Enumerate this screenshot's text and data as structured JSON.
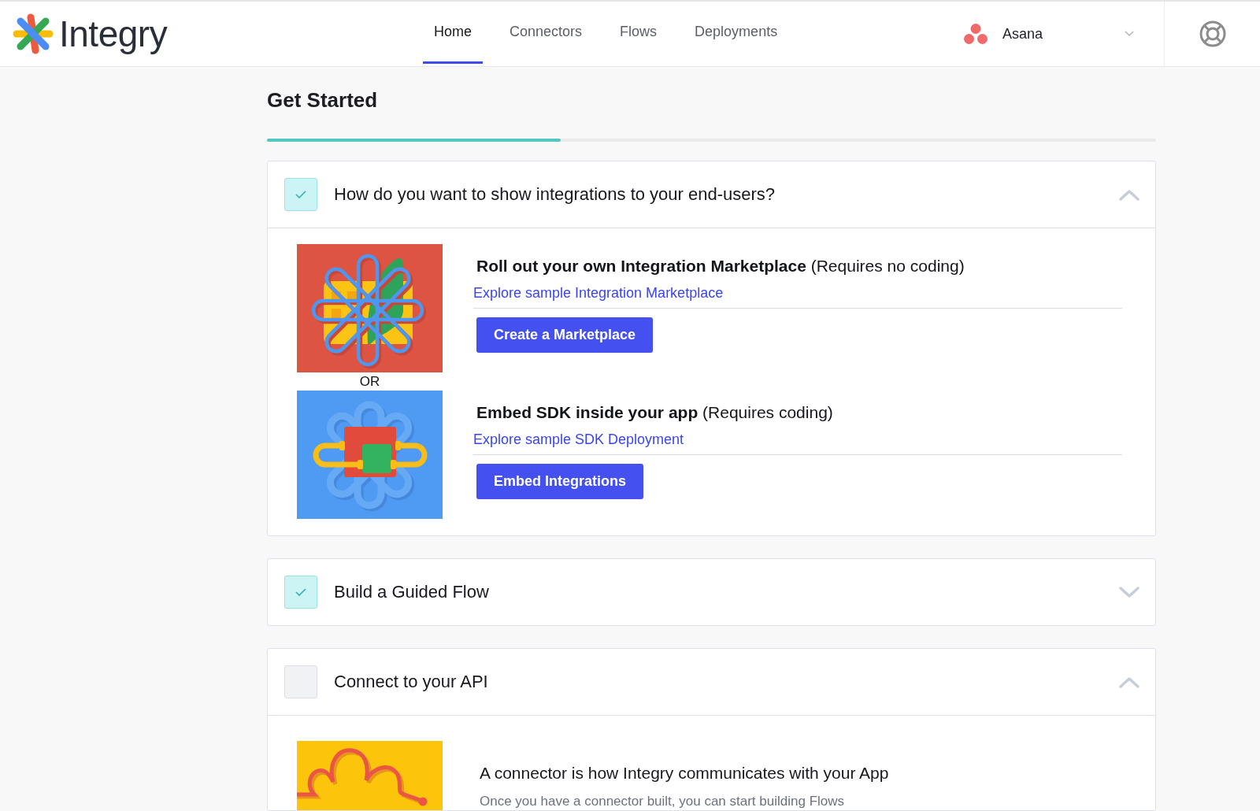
{
  "header": {
    "logo": "Integry",
    "nav": [
      {
        "label": "Home",
        "selected": true
      },
      {
        "label": "Connectors",
        "selected": false
      },
      {
        "label": "Flows",
        "selected": false
      },
      {
        "label": "Deployments",
        "selected": false
      }
    ],
    "workspace": {
      "name": "Asana"
    }
  },
  "page": {
    "title": "Get Started",
    "progress": {
      "level": 0.33
    }
  },
  "sections": [
    {
      "title": "How do you want to show integrations to your end-users?",
      "checked": true,
      "expanded": true,
      "separator": "OR",
      "options": [
        {
          "kind": "marketplace",
          "title": "**Roll out your own Integration Marketplace** (Requires no coding)",
          "link": "Explore sample Integration Marketplace",
          "button": "Create a Marketplace"
        },
        {
          "kind": "sdk",
          "title": "**Embed SDK inside your app** (Requires coding)",
          "link": "Explore sample SDK Deployment",
          "button": "Embed Integrations"
        }
      ]
    },
    {
      "title": "Build a Guided Flow",
      "checked": true,
      "expanded": false
    },
    {
      "title": "Connect to your API",
      "checked": false,
      "expanded": true,
      "info": {
        "kind": "connector",
        "title": "A connector is how Integry communicates with your App",
        "description": "Once you have a connector built, you can start building Flows"
      }
    }
  ]
}
